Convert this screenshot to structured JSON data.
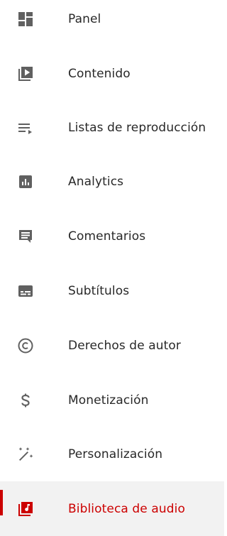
{
  "colors": {
    "icon": "#606060",
    "text": "#282828",
    "accent": "#cc0000",
    "active_bg": "#f2f2f2"
  },
  "nav": {
    "items": [
      {
        "label": "Panel",
        "icon": "dashboard-icon"
      },
      {
        "label": "Contenido",
        "icon": "video-library-icon"
      },
      {
        "label": "Listas de reproducción",
        "icon": "playlist-icon"
      },
      {
        "label": "Analytics",
        "icon": "analytics-icon"
      },
      {
        "label": "Comentarios",
        "icon": "comment-icon"
      },
      {
        "label": "Subtítulos",
        "icon": "subtitles-icon"
      },
      {
        "label": "Derechos de autor",
        "icon": "copyright-icon"
      },
      {
        "label": "Monetización",
        "icon": "dollar-icon"
      },
      {
        "label": "Personalización",
        "icon": "magic-wand-icon"
      },
      {
        "label": "Biblioteca de audio",
        "icon": "audio-library-icon",
        "active": true
      }
    ]
  }
}
